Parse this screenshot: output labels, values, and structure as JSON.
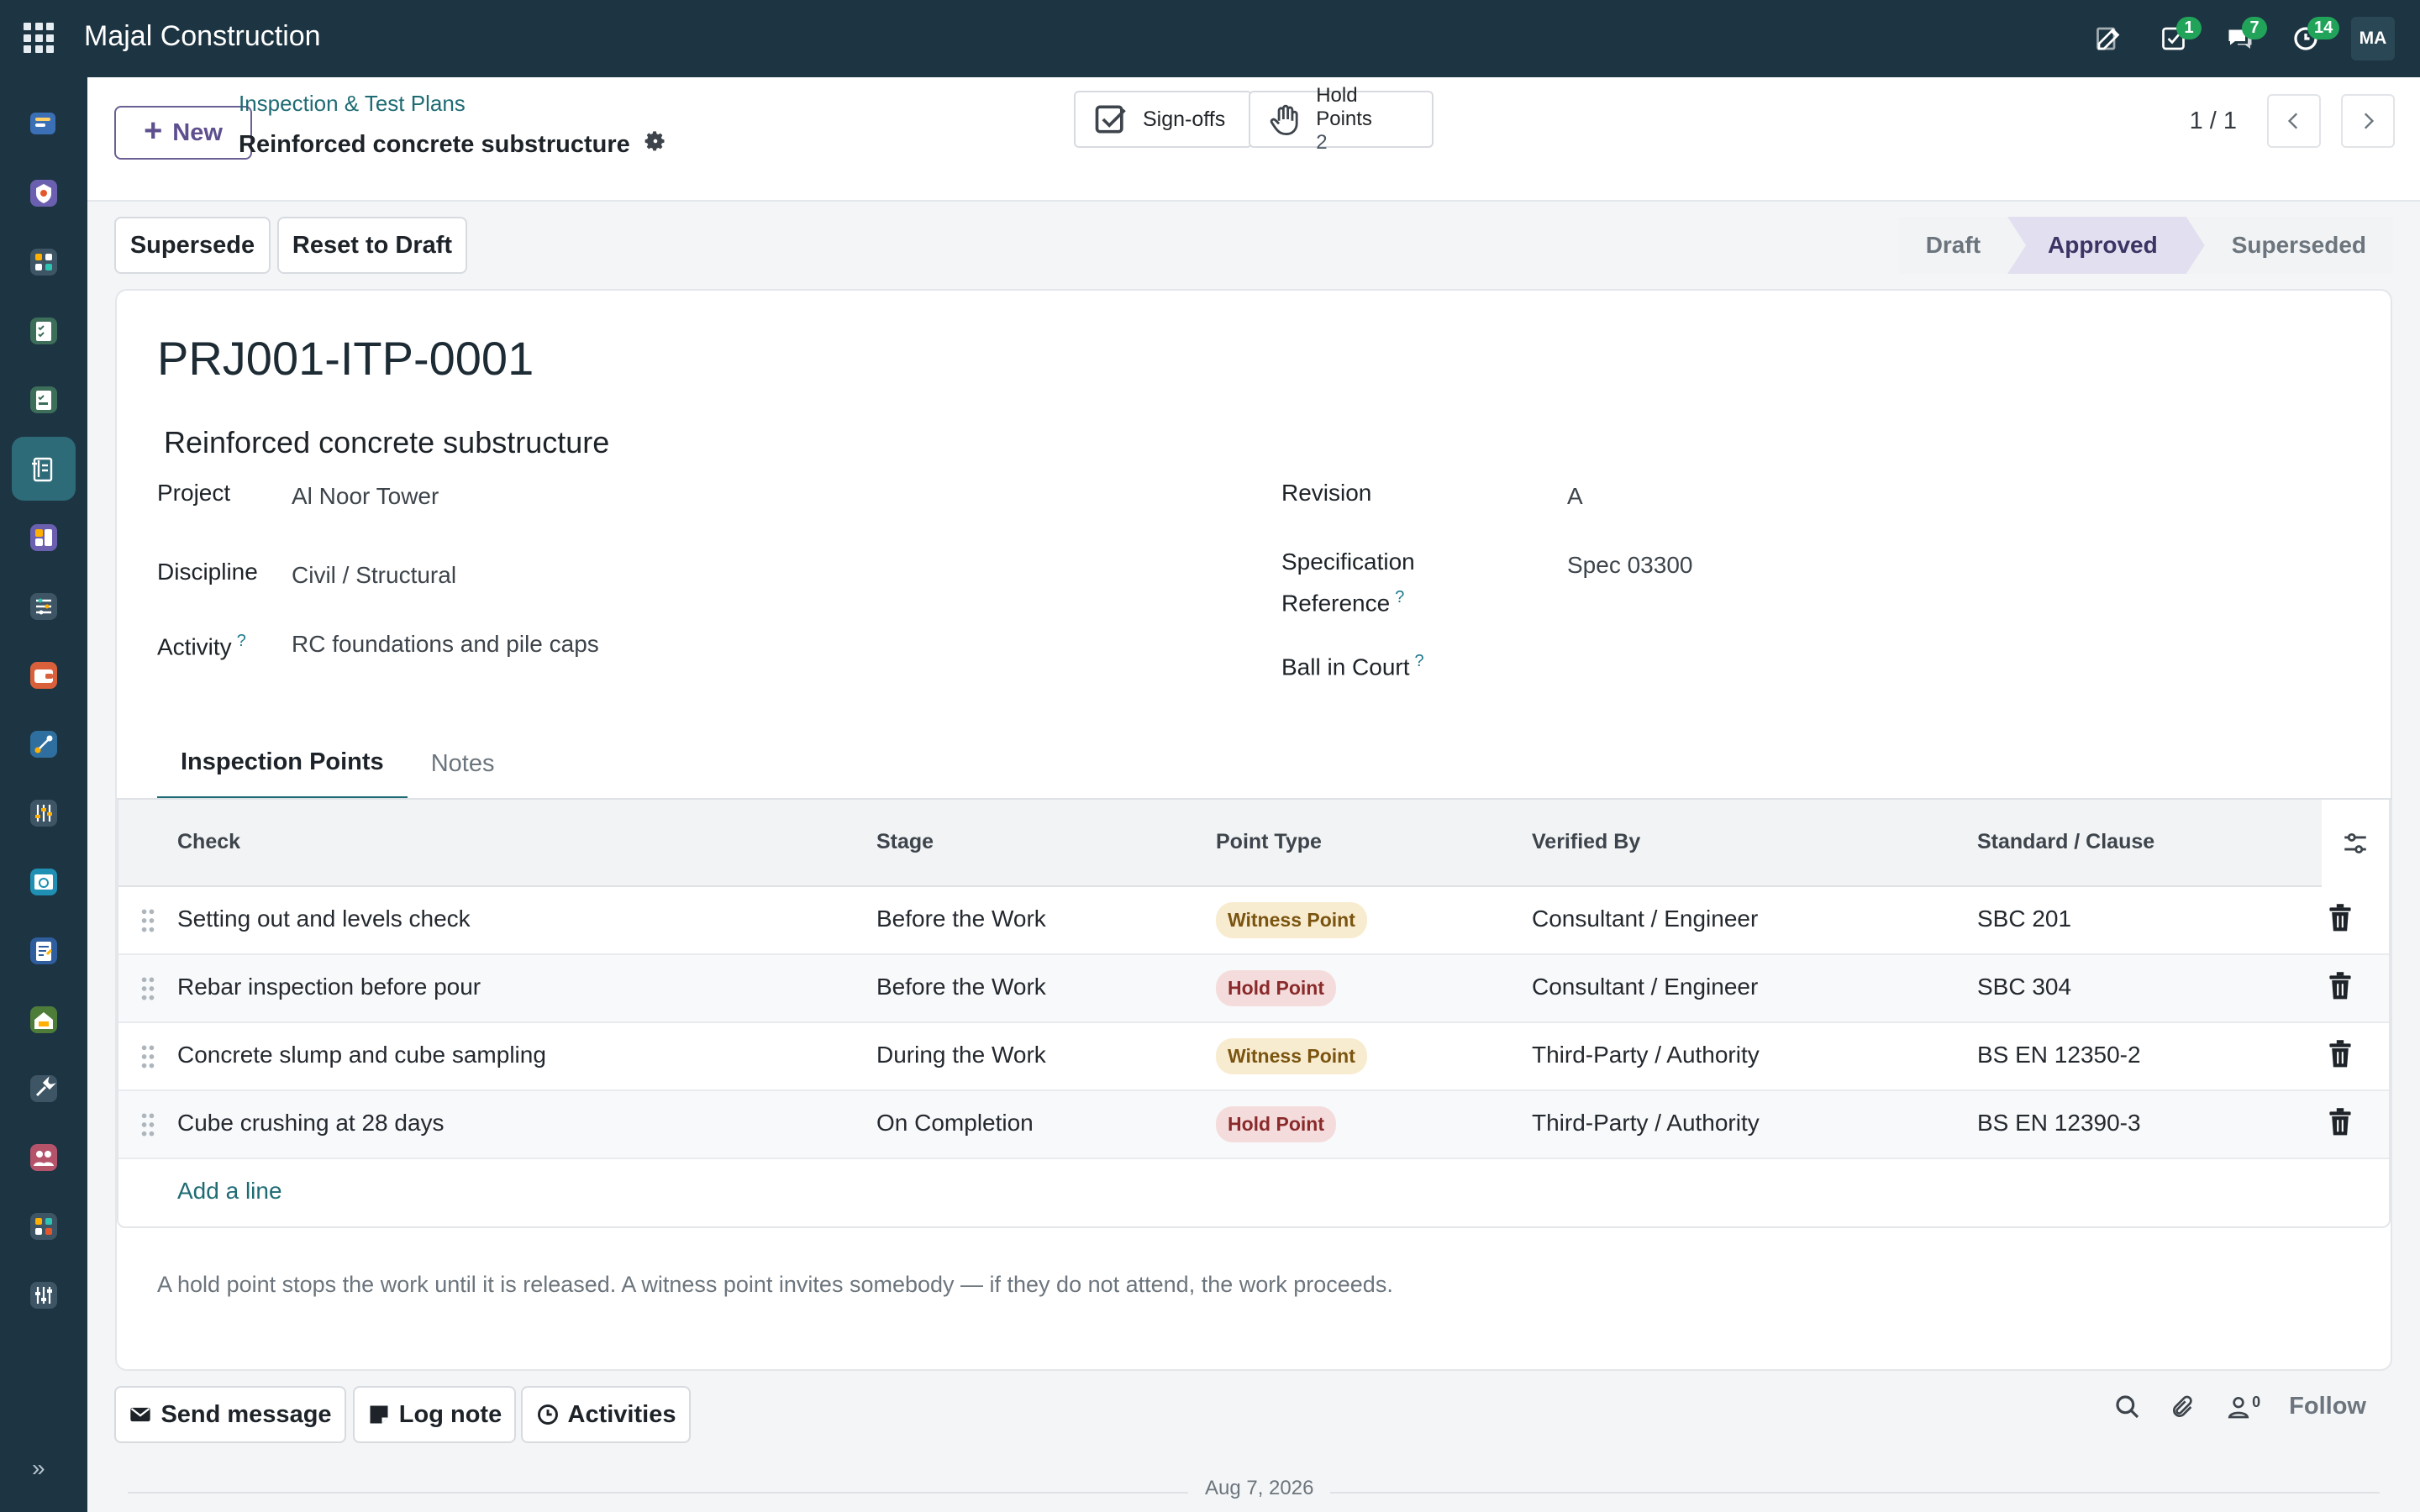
{
  "app": {
    "company": "Majal Construction",
    "user_initials": "MA",
    "badges": {
      "activities": "1",
      "messages": "7",
      "timesheets": "14"
    }
  },
  "control": {
    "new_label": "New",
    "breadcrumb": "Inspection & Test Plans",
    "record_title": "Reinforced concrete substructure",
    "signoffs_label": "Sign-offs",
    "holdpoints_label": "Hold Points",
    "holdpoints_count": "2",
    "pager": "1 / 1"
  },
  "actions": {
    "supersede": "Supersede",
    "reset": "Reset to Draft"
  },
  "statusbar": {
    "stages": [
      "Draft",
      "Approved",
      "Superseded"
    ],
    "current": "Approved"
  },
  "form": {
    "reference": "PRJ001-ITP-0001",
    "name": "Reinforced concrete substructure",
    "fields": {
      "project_label": "Project",
      "project": "Al Noor Tower",
      "discipline_label": "Discipline",
      "discipline": "Civil / Structural",
      "activity_label": "Activity",
      "activity": "RC foundations and pile caps",
      "revision_label": "Revision",
      "revision": "A",
      "spec_label_1": "Specification",
      "spec_label_2": "Reference",
      "spec": "Spec 03300",
      "ball_label": "Ball in Court",
      "ball": "",
      "help_mark": "?"
    },
    "tabs": [
      "Inspection Points",
      "Notes"
    ],
    "table": {
      "headers": [
        "Check",
        "Stage",
        "Point Type",
        "Verified By",
        "Standard / Clause"
      ],
      "rows": [
        {
          "check": "Setting out and levels check",
          "stage": "Before the Work",
          "type": "Witness Point",
          "verified": "Consultant / Engineer",
          "standard": "SBC 201"
        },
        {
          "check": "Rebar inspection before pour",
          "stage": "Before the Work",
          "type": "Hold Point",
          "verified": "Consultant / Engineer",
          "standard": "SBC 304"
        },
        {
          "check": "Concrete slump and cube sampling",
          "stage": "During the Work",
          "type": "Witness Point",
          "verified": "Third-Party / Authority",
          "standard": "BS EN 12350-2"
        },
        {
          "check": "Cube crushing at 28 days",
          "stage": "On Completion",
          "type": "Hold Point",
          "verified": "Third-Party / Authority",
          "standard": "BS EN 12390-3"
        }
      ],
      "add_line": "Add a line"
    },
    "footnote": "A hold point stops the work until it is released. A witness point invites somebody — if they do not attend, the work proceeds."
  },
  "chatter": {
    "send_message": "Send message",
    "log_note": "Log note",
    "activities": "Activities",
    "follower_count": "0",
    "follow": "Follow",
    "date": "Aug 7, 2026"
  },
  "colors": {
    "topbar": "#1d3442",
    "accent": "#1f6b74",
    "primary": "#5e4f8e"
  }
}
